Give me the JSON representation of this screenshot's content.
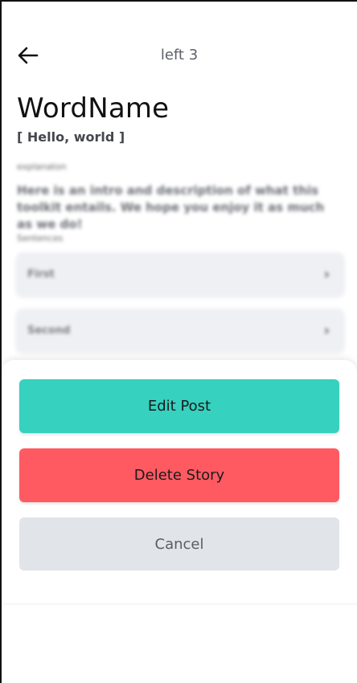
{
  "header": {
    "back_icon": "arrow-left-icon",
    "title": "left 3"
  },
  "word": {
    "title": "WordName",
    "pronunciation": "[ Hello, world ]"
  },
  "explanation": {
    "label": "explanaton",
    "text": "Here is an intro and description of what this toolkit entails. We hope you enjoy it as much as we do!"
  },
  "sentences": {
    "label": "Sentences",
    "items": [
      {
        "label": "First",
        "icon": "chevron-right-icon"
      },
      {
        "label": "Second",
        "icon": "chevron-right-icon"
      }
    ]
  },
  "sheet": {
    "edit_label": "Edit Post",
    "delete_label": "Delete Story",
    "cancel_label": "Cancel"
  },
  "colors": {
    "edit": "#37d1bf",
    "delete": "#ff5a62",
    "cancel": "#e1e4e8"
  }
}
